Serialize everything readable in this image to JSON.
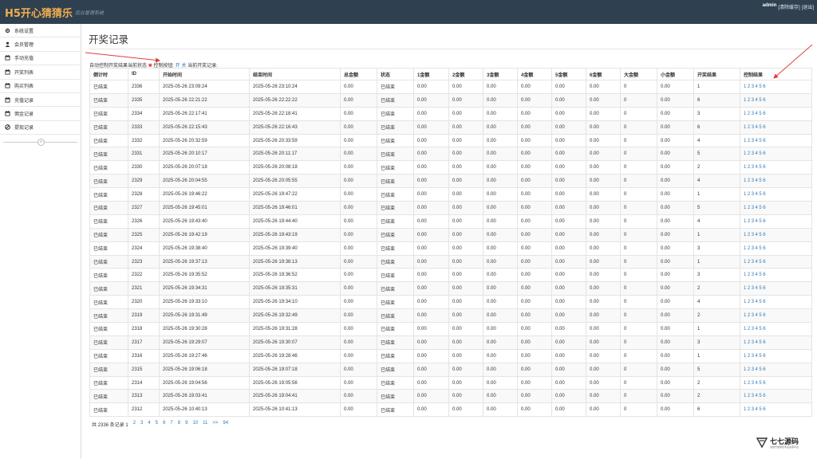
{
  "header": {
    "brand": "H5开心猜猜乐",
    "subtitle": "后台管理系统",
    "username": "admin",
    "clear_cache": "[清除缓存]",
    "logout": "[退出]"
  },
  "sidebar": {
    "items": [
      {
        "label": "系统设置",
        "icon": "gear-icon"
      },
      {
        "label": "会员管理",
        "icon": "user-icon"
      },
      {
        "label": "手动充值",
        "icon": "calendar-icon"
      },
      {
        "label": "开奖列表",
        "icon": "calendar-icon"
      },
      {
        "label": "购买列表",
        "icon": "calendar-icon"
      },
      {
        "label": "充值记录",
        "icon": "calendar-icon"
      },
      {
        "label": "佣金记录",
        "icon": "calendar-icon"
      },
      {
        "label": "提现记录",
        "icon": "ban-icon"
      }
    ],
    "collapse_glyph": "«"
  },
  "page": {
    "title": "开奖记录",
    "status": {
      "prefix": "自动控制开奖结果当前状态",
      "state_glyph": "✖",
      "control_label": "控制按钮:",
      "on": "开",
      "off": "关",
      "current_label": "当前开奖记录:"
    }
  },
  "table": {
    "columns": [
      "倒计时",
      "ID",
      "开始时间",
      "结束时间",
      "总金额",
      "状态",
      "1金额",
      "2金额",
      "3金额",
      "4金额",
      "5金额",
      "6金额",
      "大金额",
      "小金额",
      "开奖结果",
      "控制结果"
    ],
    "control_links": [
      "1",
      "2",
      "3",
      "4",
      "5",
      "6"
    ],
    "rows": [
      [
        "已结束",
        "2336",
        "2025-05-26 23:09:24",
        "2025-05-26 23:10:24",
        "0.00",
        "已结束",
        "0.00",
        "0.00",
        "0.00",
        "0.00",
        "0.00",
        "0.00",
        "0",
        "0.00",
        "1"
      ],
      [
        "已结束",
        "2335",
        "2025-05-26 22:21:22",
        "2025-05-26 22:22:22",
        "0.00",
        "已结束",
        "0.00",
        "0.00",
        "0.00",
        "0.00",
        "0.00",
        "0.00",
        "0",
        "0.00",
        "6"
      ],
      [
        "已结束",
        "2334",
        "2025-05-26 22:17:41",
        "2025-05-26 22:18:41",
        "0.00",
        "已结束",
        "0.00",
        "0.00",
        "0.00",
        "0.00",
        "0.00",
        "0.00",
        "0",
        "0.00",
        "3"
      ],
      [
        "已结束",
        "2333",
        "2025-05-26 22:15:43",
        "2025-05-26 22:16:43",
        "0.00",
        "已结束",
        "0.00",
        "0.00",
        "0.00",
        "0.00",
        "0.00",
        "0.00",
        "0",
        "0.00",
        "6"
      ],
      [
        "已结束",
        "2332",
        "2025-05-26 20:32:59",
        "2025-05-26 20:33:59",
        "0.00",
        "已结束",
        "0.00",
        "0.00",
        "0.00",
        "0.00",
        "0.00",
        "0.00",
        "0",
        "0.00",
        "4"
      ],
      [
        "已结束",
        "2331",
        "2025-05-26 20:10:17",
        "2025-05-26 20:11:17",
        "0.00",
        "已结束",
        "0.00",
        "0.00",
        "0.00",
        "0.00",
        "0.00",
        "0.00",
        "0",
        "0.00",
        "5"
      ],
      [
        "已结束",
        "2330",
        "2025-05-26 20:07:18",
        "2025-05-26 20:08:18",
        "0.00",
        "已结束",
        "0.00",
        "0.00",
        "0.00",
        "0.00",
        "0.00",
        "0.00",
        "0",
        "0.00",
        "2"
      ],
      [
        "已结束",
        "2329",
        "2025-05-26 20:04:55",
        "2025-05-26 20:05:55",
        "0.00",
        "已结束",
        "0.00",
        "0.00",
        "0.00",
        "0.00",
        "0.00",
        "0.00",
        "0",
        "0.00",
        "4"
      ],
      [
        "已结束",
        "2328",
        "2025-05-26 19:46:22",
        "2025-05-26 19:47:22",
        "0.00",
        "已结束",
        "0.00",
        "0.00",
        "0.00",
        "0.00",
        "0.00",
        "0.00",
        "0",
        "0.00",
        "1"
      ],
      [
        "已结束",
        "2327",
        "2025-05-26 19:45:01",
        "2025-05-26 19:46:01",
        "0.00",
        "已结束",
        "0.00",
        "0.00",
        "0.00",
        "0.00",
        "0.00",
        "0.00",
        "0",
        "0.00",
        "5"
      ],
      [
        "已结束",
        "2326",
        "2025-05-26 19:43:40",
        "2025-05-26 19:44:40",
        "0.00",
        "已结束",
        "0.00",
        "0.00",
        "0.00",
        "0.00",
        "0.00",
        "0.00",
        "0",
        "0.00",
        "4"
      ],
      [
        "已结束",
        "2325",
        "2025-05-26 19:42:19",
        "2025-05-26 19:43:19",
        "0.00",
        "已结束",
        "0.00",
        "0.00",
        "0.00",
        "0.00",
        "0.00",
        "0.00",
        "0",
        "0.00",
        "1"
      ],
      [
        "已结束",
        "2324",
        "2025-05-26 19:38:40",
        "2025-05-26 19:39:40",
        "0.00",
        "已结束",
        "0.00",
        "0.00",
        "0.00",
        "0.00",
        "0.00",
        "0.00",
        "0",
        "0.00",
        "3"
      ],
      [
        "已结束",
        "2323",
        "2025-05-26 19:37:13",
        "2025-05-26 19:38:13",
        "0.00",
        "已结束",
        "0.00",
        "0.00",
        "0.00",
        "0.00",
        "0.00",
        "0.00",
        "0",
        "0.00",
        "1"
      ],
      [
        "已结束",
        "2322",
        "2025-05-26 19:35:52",
        "2025-05-26 19:36:52",
        "0.00",
        "已结束",
        "0.00",
        "0.00",
        "0.00",
        "0.00",
        "0.00",
        "0.00",
        "0",
        "0.00",
        "3"
      ],
      [
        "已结束",
        "2321",
        "2025-05-26 19:34:31",
        "2025-05-26 19:35:31",
        "0.00",
        "已结束",
        "0.00",
        "0.00",
        "0.00",
        "0.00",
        "0.00",
        "0.00",
        "0",
        "0.00",
        "2"
      ],
      [
        "已结束",
        "2320",
        "2025-05-26 19:33:10",
        "2025-05-26 19:34:10",
        "0.00",
        "已结束",
        "0.00",
        "0.00",
        "0.00",
        "0.00",
        "0.00",
        "0.00",
        "0",
        "0.00",
        "4"
      ],
      [
        "已结束",
        "2319",
        "2025-05-26 19:31:49",
        "2025-05-26 19:32:49",
        "0.00",
        "已结束",
        "0.00",
        "0.00",
        "0.00",
        "0.00",
        "0.00",
        "0.00",
        "0",
        "0.00",
        "2"
      ],
      [
        "已结束",
        "2318",
        "2025-05-26 19:30:28",
        "2025-05-26 19:31:28",
        "0.00",
        "已结束",
        "0.00",
        "0.00",
        "0.00",
        "0.00",
        "0.00",
        "0.00",
        "0",
        "0.00",
        "1"
      ],
      [
        "已结束",
        "2317",
        "2025-05-26 19:29:07",
        "2025-05-26 19:30:07",
        "0.00",
        "已结束",
        "0.00",
        "0.00",
        "0.00",
        "0.00",
        "0.00",
        "0.00",
        "0",
        "0.00",
        "3"
      ],
      [
        "已结束",
        "2316",
        "2025-05-26 19:27:46",
        "2025-05-26 19:28:46",
        "0.00",
        "已结束",
        "0.00",
        "0.00",
        "0.00",
        "0.00",
        "0.00",
        "0.00",
        "0",
        "0.00",
        "1"
      ],
      [
        "已结束",
        "2315",
        "2025-05-26 19:06:18",
        "2025-05-26 19:07:18",
        "0.00",
        "已结束",
        "0.00",
        "0.00",
        "0.00",
        "0.00",
        "0.00",
        "0.00",
        "0",
        "0.00",
        "5"
      ],
      [
        "已结束",
        "2314",
        "2025-05-26 19:04:56",
        "2025-05-26 19:05:56",
        "0.00",
        "已结束",
        "0.00",
        "0.00",
        "0.00",
        "0.00",
        "0.00",
        "0.00",
        "0",
        "0.00",
        "2"
      ],
      [
        "已结束",
        "2313",
        "2025-05-26 19:03:41",
        "2025-05-26 19:04:41",
        "0.00",
        "已结束",
        "0.00",
        "0.00",
        "0.00",
        "0.00",
        "0.00",
        "0.00",
        "0",
        "0.00",
        "2"
      ],
      [
        "已结束",
        "2312",
        "2025-05-26 10:40:13",
        "2025-05-26 10:41:13",
        "0.00",
        "已结束",
        "0.00",
        "0.00",
        "0.00",
        "0.00",
        "0.00",
        "0.00",
        "0",
        "0.00",
        "6"
      ]
    ]
  },
  "pagination": {
    "summary": "共 2336 条记录 1",
    "pages": [
      "2",
      "3",
      "4",
      "5",
      "6",
      "7",
      "8",
      "9",
      "10",
      "11"
    ],
    "next": ">>",
    "last": "94"
  },
  "watermark": {
    "name": "七七源码",
    "slogan": "全栈开发项目专业资源平台"
  },
  "colors": {
    "header_bg": "#2f4050",
    "brand": "#f0ad4e",
    "link": "#337ab7",
    "annotation_arrow": "#e03b3b"
  }
}
